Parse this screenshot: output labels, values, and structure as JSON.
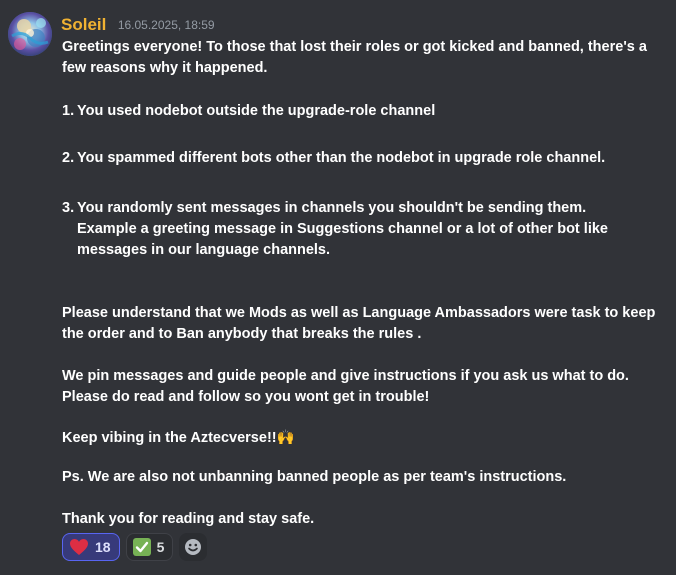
{
  "message": {
    "author": "Soleil",
    "timestamp": "16.05.2025, 18:59",
    "intro": " Greetings everyone!  To those that lost their roles or got kicked and banned, there's a few reasons why it happened.",
    "reasons": [
      {
        "number": "1.",
        "text": "You used nodebot outside the upgrade-role channel"
      },
      {
        "number": "2.",
        "text": "You spammed different bots other than the nodebot in upgrade role channel."
      },
      {
        "number": "3.",
        "text": "You randomly sent messages in channels you shouldn't be sending them. Example a greeting message in Suggestions channel or a lot of other bot like messages in our language channels."
      }
    ],
    "para_understand": "Please understand that we Mods as well as Language Ambassadors were task to keep the order and to Ban anybody that breaks the rules .",
    "para_pin": "We pin messages and guide people and give instructions if you ask us what to do. Please do read and follow so you wont get in trouble!",
    "para_vibing": "Keep vibing in the Aztecverse!!",
    "vibing_emoji": "🙌",
    "para_ps": "Ps. We are also not unbanning banned people as per team's instructions.",
    "para_thanks": "Thank you for reading and stay safe."
  },
  "reactions": [
    {
      "emoji": "heart-icon",
      "count": "18",
      "active": true,
      "color": "#dd2e44"
    },
    {
      "emoji": "check-mark-icon",
      "count": "5",
      "active": false,
      "color": "#77b255"
    }
  ],
  "add_reaction": {
    "icon": "smiley-add-icon"
  },
  "colors": {
    "background": "#313338",
    "username": "#f0b232",
    "timestamp": "#949ba4",
    "text": "#ffffff",
    "reaction_active_bg": "#373a7a",
    "reaction_active_border": "#5865f2"
  }
}
